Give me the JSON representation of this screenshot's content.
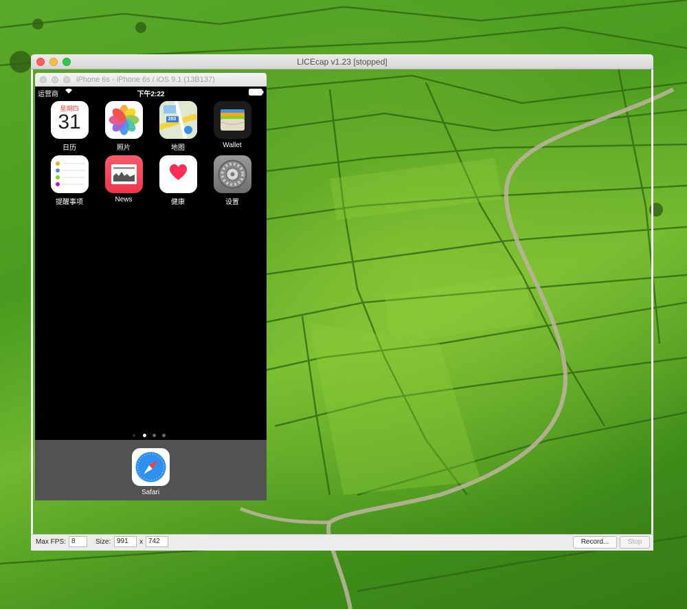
{
  "licecap": {
    "title": "LICEcap v1.23 [stopped]",
    "max_fps_label": "Max FPS:",
    "max_fps_value": "8",
    "size_label": "Size:",
    "width_value": "991",
    "size_separator": "x",
    "height_value": "742",
    "record_button": "Record...",
    "stop_button": "Stop"
  },
  "simulator": {
    "title": "iPhone 6s - iPhone 6s / iOS 9.1 (13B137)",
    "status_bar": {
      "carrier": "运营商",
      "time": "下午2:22"
    },
    "calendar_icon": {
      "weekday": "星期四",
      "day": "31"
    },
    "apps": [
      {
        "label": "日历",
        "icon": "calendar-icon"
      },
      {
        "label": "照片",
        "icon": "photos-icon"
      },
      {
        "label": "地图",
        "icon": "maps-icon"
      },
      {
        "label": "Wallet",
        "icon": "wallet-icon"
      },
      {
        "label": "提醒事项",
        "icon": "reminders-icon"
      },
      {
        "label": "News",
        "icon": "news-icon"
      },
      {
        "label": "健康",
        "icon": "health-icon"
      },
      {
        "label": "设置",
        "icon": "settings-icon"
      }
    ],
    "maps_icon_text": "280",
    "page_indicator": {
      "pages": 3,
      "current": 1
    },
    "dock": [
      {
        "label": "Safari",
        "icon": "safari-icon"
      }
    ]
  },
  "colors": {
    "desktop_green": "#4a9a1f",
    "close": "#fc605c",
    "minimize": "#fdbc40",
    "maximize": "#34c84a"
  }
}
